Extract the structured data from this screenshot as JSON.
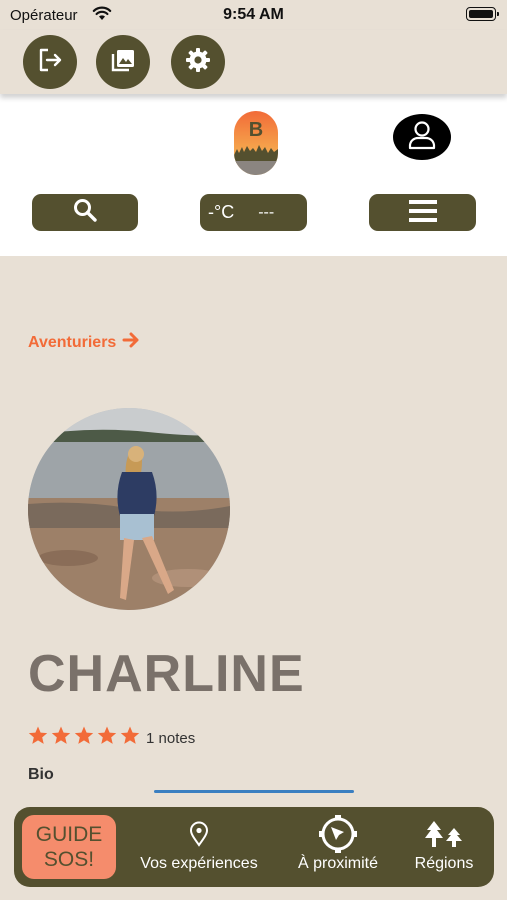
{
  "status_bar": {
    "carrier": "Opérateur",
    "time": "9:54 AM",
    "icons": [
      "wifi-icon",
      "battery-icon"
    ]
  },
  "topbar": {
    "buttons": [
      {
        "name": "logout-button",
        "icon": "logout-icon"
      },
      {
        "name": "gallery-button",
        "icon": "image-gallery-icon"
      },
      {
        "name": "settings-button",
        "icon": "gear-icon"
      }
    ]
  },
  "header": {
    "logo_letter": "B",
    "profile_icon": "user-icon",
    "search_icon": "search-icon",
    "weather": {
      "temperature": "-°C",
      "condition": "---"
    },
    "menu_icon": "hamburger-icon"
  },
  "main": {
    "breadcrumb": "Aventuriers",
    "profile": {
      "name": "CHARLINE",
      "rating_stars": 5,
      "rating_max": 5,
      "rating_count_text": "1 notes",
      "bio_label": "Bio"
    }
  },
  "tabbar": {
    "sos_line1": "GUIDE",
    "sos_line2": "SOS!",
    "tabs": [
      {
        "label": "Vos expériences",
        "icon": "location-pin-icon"
      },
      {
        "label": "À proximité",
        "icon": "compass-icon"
      },
      {
        "label": "Régions",
        "icon": "trees-icon"
      }
    ]
  },
  "colors": {
    "olive": "#54502f",
    "beige": "#e8e0d5",
    "accent_orange": "#f26b38",
    "sos_salmon": "#f58c6c",
    "link_blue": "#3a7fc1"
  }
}
